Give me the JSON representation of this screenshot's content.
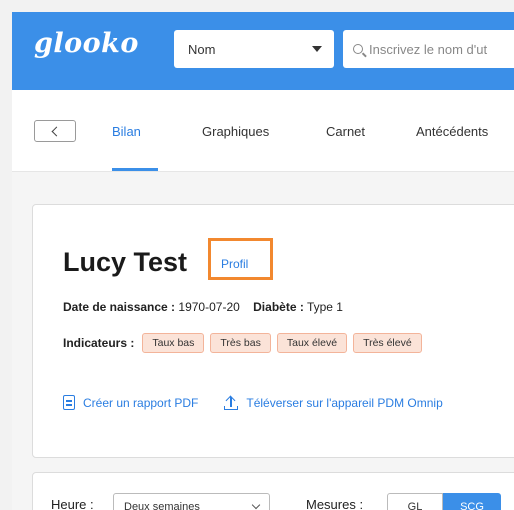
{
  "header": {
    "logo": "glooko",
    "search_type": "Nom",
    "search_placeholder": "Inscrivez le nom d'ut"
  },
  "tabs": [
    {
      "label": "Bilan",
      "active": true
    },
    {
      "label": "Graphiques"
    },
    {
      "label": "Carnet"
    },
    {
      "label": "Antécédents"
    }
  ],
  "patient": {
    "name": "Lucy Test",
    "profile_link": "Profil",
    "dob_label": "Date de naissance :",
    "dob_value": "1970-07-20",
    "diabetes_label": "Diabète :",
    "diabetes_value": "Type 1",
    "indicators_label": "Indicateurs :",
    "indicators": [
      "Taux bas",
      "Très bas",
      "Taux élevé",
      "Très élevé"
    ]
  },
  "actions": {
    "pdf": "Créer un rapport PDF",
    "upload": "Téléverser sur l'appareil PDM Omnip"
  },
  "filters": {
    "time_label": "Heure :",
    "time_value": "Deux semaines",
    "measures_label": "Mesures :",
    "gl": "GL",
    "scg": "SCG"
  },
  "colors": {
    "brand": "#3b8fe8",
    "link": "#2a7de1",
    "highlight": "#f2882f",
    "flag_bg": "#fbe3d8"
  }
}
